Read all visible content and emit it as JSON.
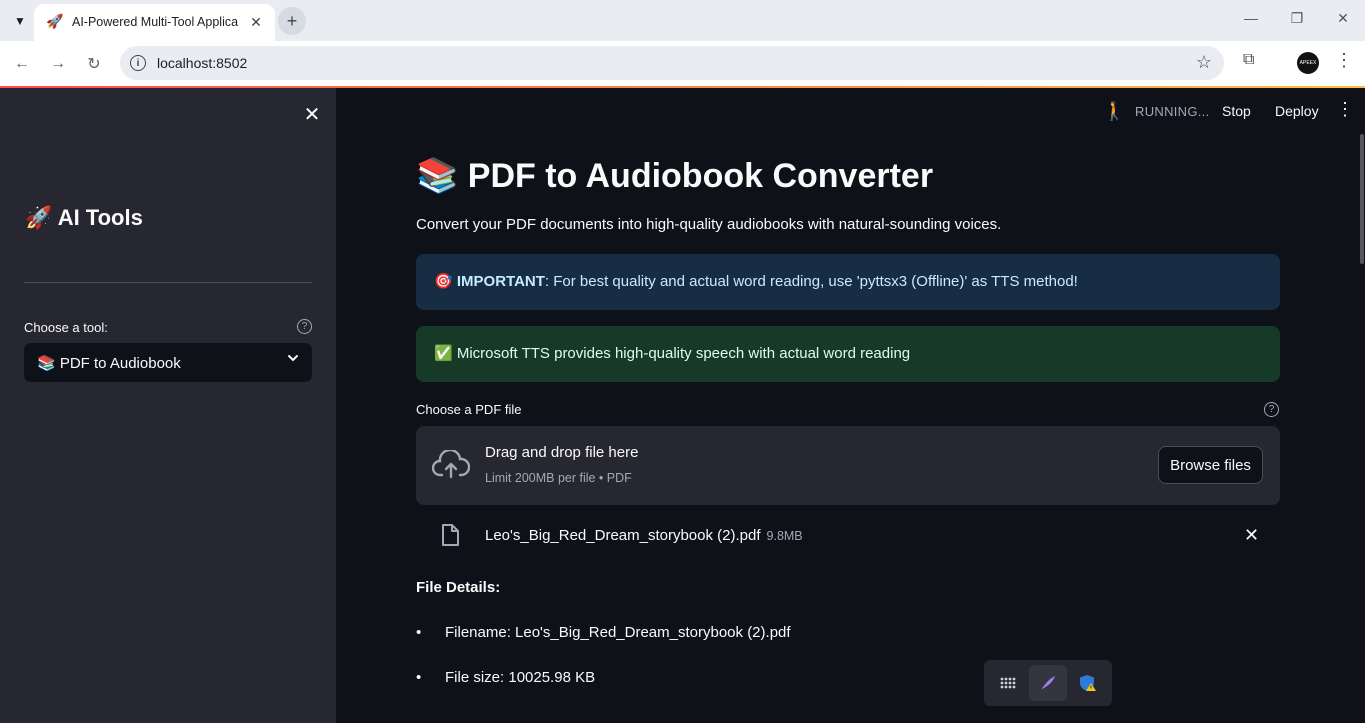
{
  "browser": {
    "tab_title": "AI-Powered Multi-Tool Applicat",
    "url": "localhost:8502",
    "profile_label": "APEEX"
  },
  "sidebar": {
    "title": "🚀 AI Tools",
    "tool_label": "Choose a tool:",
    "tool_selected": "📚 PDF to Audiobook"
  },
  "header": {
    "status": "RUNNING...",
    "stop_label": "Stop",
    "deploy_label": "Deploy"
  },
  "main": {
    "title": "📚 PDF to Audiobook Converter",
    "subtitle": "Convert your PDF documents into high-quality audiobooks with natural-sounding voices.",
    "info_alert": {
      "icon": "🎯",
      "strong": "IMPORTANT",
      "text": ": For best quality and actual word reading, use 'pyttsx3 (Offline)' as TTS method!"
    },
    "success_alert": {
      "icon": "✅",
      "text": "Microsoft TTS provides high-quality speech with actual word reading"
    },
    "uploader": {
      "label": "Choose a PDF file",
      "drop_title": "Drag and drop file here",
      "drop_limit": "Limit 200MB per file • PDF",
      "browse_label": "Browse files"
    },
    "uploaded_file": {
      "name": "Leo's_Big_Red_Dream_storybook (2).pdf",
      "size": "9.8MB"
    },
    "details_heading": "File Details:",
    "details": [
      "Filename: Leo's_Big_Red_Dream_storybook (2).pdf",
      "File size: 10025.98 KB"
    ]
  },
  "colors": {
    "background": "#0e1117",
    "sidebar": "#262730",
    "info_bg": "#172d43",
    "success_bg": "#173928",
    "accent": "#ff4b4b"
  }
}
